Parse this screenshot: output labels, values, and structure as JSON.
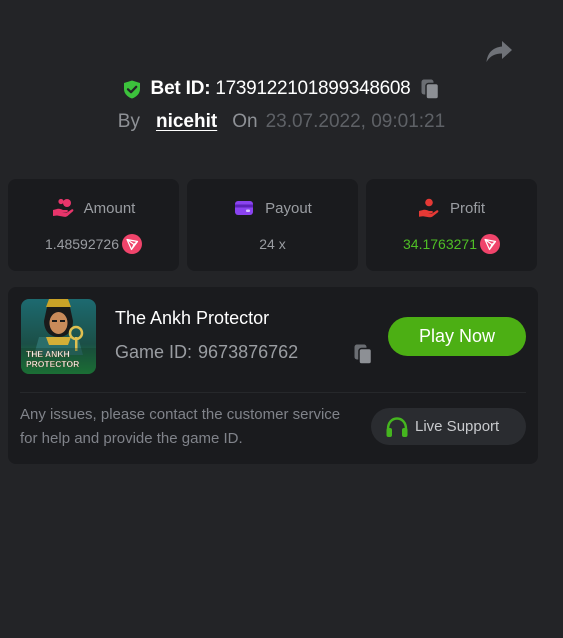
{
  "bet": {
    "id_label": "Bet ID:",
    "id_value": "1739122101899348608",
    "by_label": "By",
    "username": "nicehit",
    "on_label": "On",
    "datetime": "23.07.2022, 09:01:21"
  },
  "stats": {
    "amount_label": "Amount",
    "amount_value": "1.48592726",
    "payout_label": "Payout",
    "payout_value": "24 x",
    "profit_label": "Profit",
    "profit_value": "34.1763271"
  },
  "game": {
    "title": "The Ankh Protector",
    "id_label": "Game ID:",
    "id_value": "9673876762",
    "thumb_text_line1": "THE ANKH",
    "thumb_text_line2": "PROTECTOR",
    "play_label": "Play Now",
    "help_text": "Any issues, please contact the customer service for help and provide the game ID.",
    "support_label": "Live Support"
  },
  "colors": {
    "background": "#232427",
    "card": "#1a1b1e",
    "accent_green": "#4caf14",
    "profit_green": "#4fbf26",
    "verified_green": "#3cc23c",
    "amount_icon": "#e8356b",
    "payout_icon": "#8a43f0",
    "profit_icon": "#e53935",
    "trx_red": "#f0446b"
  },
  "icons": {
    "share": "share-icon",
    "verified": "shield-check-icon",
    "copy": "copy-icon",
    "amount": "coins-hand-icon",
    "payout": "wallet-icon",
    "profit": "hand-coin-icon",
    "currency": "trx-icon",
    "support": "headset-icon"
  }
}
